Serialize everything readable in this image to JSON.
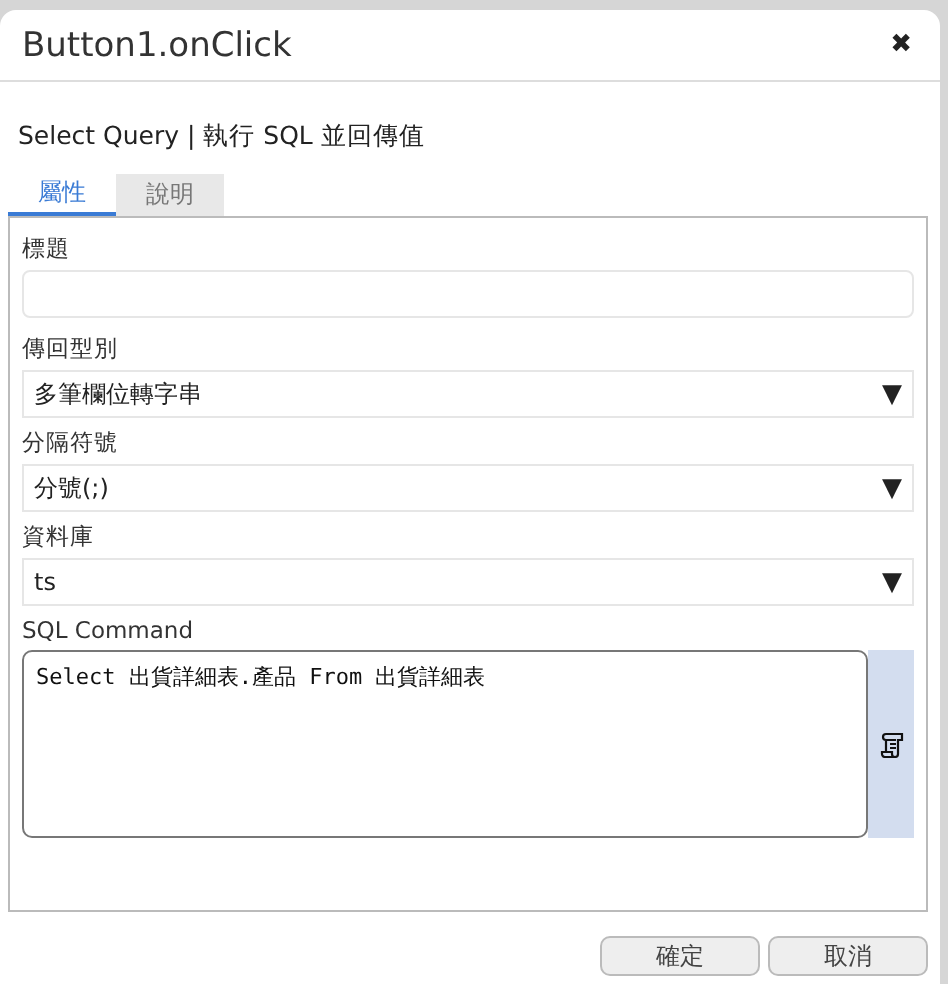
{
  "window": {
    "title": "Button1.onClick",
    "close": "✖"
  },
  "subtitle": "Select Query | 執行 SQL 並回傳值",
  "tabs": [
    {
      "label": "屬性",
      "selected": true
    },
    {
      "label": "說明",
      "selected": false
    }
  ],
  "fields": [
    {
      "kind": "text",
      "label": "標題"
    },
    {
      "kind": "select",
      "label": "傳回型別",
      "value": "多筆欄位轉字串",
      "arrow": "▼"
    },
    {
      "kind": "select",
      "label": "分隔符號",
      "value": "分號(;)",
      "arrow": "▼"
    },
    {
      "kind": "select",
      "label": "資料庫",
      "value": "ts",
      "arrow": "▼"
    },
    {
      "kind": "code",
      "label": "SQL Command",
      "value": "Select 出貨詳細表.產品 From 出貨詳細表"
    }
  ],
  "buttons": [
    "確定",
    "取消"
  ]
}
